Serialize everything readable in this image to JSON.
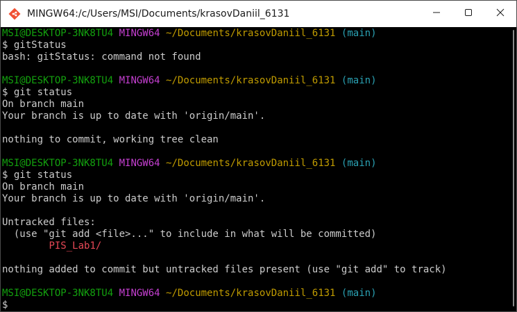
{
  "window": {
    "title": "MINGW64:/c/Users/MSI/Documents/krasovDaniil_6131",
    "icon": "git-bash-icon",
    "controls": [
      "minimize-icon",
      "maximize-icon",
      "close-icon"
    ]
  },
  "colors": {
    "user_host": "#13a10e",
    "msystem": "#c43fd0",
    "path": "#c19c00",
    "branch": "#2aa1b3",
    "untracked": "#e74856",
    "text": "#cccccc"
  },
  "prompt": {
    "user_host": "MSI@DESKTOP-3NK8TU4",
    "msystem": "MINGW64",
    "path": "~/Documents/krasovDaniil_6131",
    "branch": "(main)",
    "symbol": "$"
  },
  "session": [
    {
      "type": "prompt"
    },
    {
      "type": "command",
      "text": "$ gitStatus"
    },
    {
      "type": "output",
      "text": "bash: gitStatus: command not found"
    },
    {
      "type": "blank"
    },
    {
      "type": "prompt"
    },
    {
      "type": "command",
      "text": "$ git status"
    },
    {
      "type": "output",
      "text": "On branch main"
    },
    {
      "type": "output",
      "text": "Your branch is up to date with 'origin/main'."
    },
    {
      "type": "blank"
    },
    {
      "type": "output",
      "text": "nothing to commit, working tree clean"
    },
    {
      "type": "blank"
    },
    {
      "type": "prompt"
    },
    {
      "type": "command",
      "text": "$ git status"
    },
    {
      "type": "output",
      "text": "On branch main"
    },
    {
      "type": "output",
      "text": "Your branch is up to date with 'origin/main'."
    },
    {
      "type": "blank"
    },
    {
      "type": "output",
      "text": "Untracked files:"
    },
    {
      "type": "output",
      "text": "  (use \"git add <file>...\" to include in what will be committed)"
    },
    {
      "type": "untracked",
      "indent": "        ",
      "text": "PIS_Lab1/"
    },
    {
      "type": "blank"
    },
    {
      "type": "output",
      "text": "nothing added to commit but untracked files present (use \"git add\" to track)"
    },
    {
      "type": "blank"
    },
    {
      "type": "prompt"
    },
    {
      "type": "command",
      "text": "$ "
    }
  ]
}
